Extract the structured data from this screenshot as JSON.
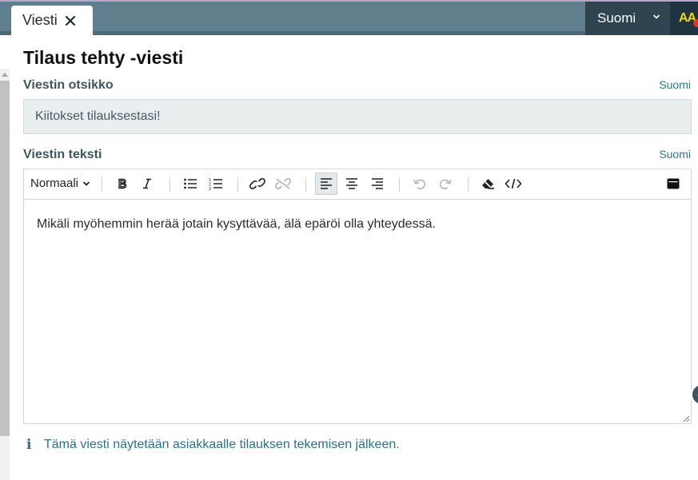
{
  "tab": {
    "label": "Viesti"
  },
  "language_switch": {
    "label": "Suomi"
  },
  "accessibility": {
    "label": "AA"
  },
  "page": {
    "title": "Tilaus tehty -viesti"
  },
  "subject": {
    "label": "Viestin otsikko",
    "language": "Suomi",
    "value": "Kiitokset tilauksestasi!"
  },
  "body": {
    "label": "Viestin teksti",
    "language": "Suomi",
    "format": "Normaali",
    "text": "Mikäli myöhemmin herää jotain kysyttävää, älä epäröi olla yhteydessä."
  },
  "info": {
    "text": "Tämä viesti näytetään asiakkaalle tilauksen tekemisen jälkeen."
  },
  "colors": {
    "header": "#607f8e",
    "language_switch": "#2f4450",
    "accent_link": "#2f7890",
    "input_background": "#e9eef0",
    "notification_dot": "#e8331e",
    "accessibility_text": "#f0d814"
  },
  "icons": {
    "tab_close": "close-icon",
    "language_dropdown": "chevron-down-icon",
    "toolbar": [
      "bold-icon",
      "italic-icon",
      "bullet-list-icon",
      "numbered-list-icon",
      "link-icon",
      "unlink-icon",
      "align-left-icon",
      "align-center-icon",
      "align-right-icon",
      "undo-icon",
      "redo-icon",
      "clear-format-icon",
      "code-view-icon",
      "fullscreen-icon"
    ],
    "info": "info-icon"
  }
}
